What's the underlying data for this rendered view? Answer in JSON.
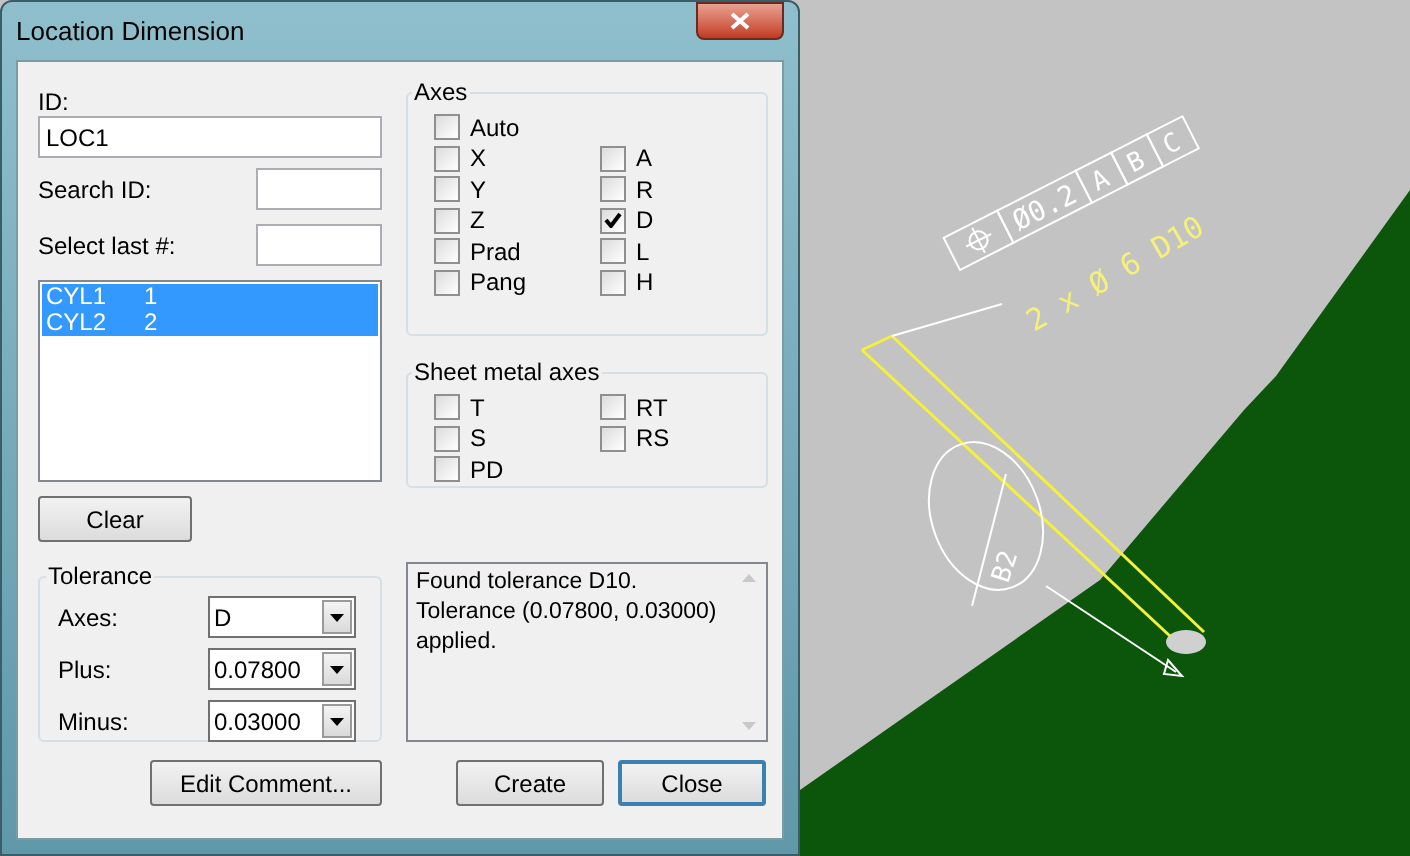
{
  "window": {
    "title": "Location Dimension"
  },
  "id_field": {
    "label": "ID:",
    "value": "LOC1"
  },
  "search_id": {
    "label": "Search ID:"
  },
  "select_last": {
    "label": "Select last #:"
  },
  "feature_list": [
    {
      "name": "CYL1",
      "number": "1",
      "selected": true
    },
    {
      "name": "CYL2",
      "number": "2",
      "selected": true
    }
  ],
  "clear_button": "Clear",
  "axes": {
    "title": "Axes",
    "rows": [
      [
        {
          "label": "Auto",
          "checked": false
        }
      ],
      [
        {
          "label": "X",
          "checked": false
        },
        {
          "label": "A",
          "checked": false
        }
      ],
      [
        {
          "label": "Y",
          "checked": false
        },
        {
          "label": "R",
          "checked": false
        }
      ],
      [
        {
          "label": "Z",
          "checked": false
        },
        {
          "label": "D",
          "checked": true
        }
      ],
      [
        {
          "label": "Prad",
          "checked": false
        },
        {
          "label": "L",
          "checked": false
        }
      ],
      [
        {
          "label": "Pang",
          "checked": false
        },
        {
          "label": "H",
          "checked": false
        }
      ]
    ]
  },
  "sheet_metal_axes": {
    "title": "Sheet metal axes",
    "rows": [
      [
        {
          "label": "T",
          "checked": false
        },
        {
          "label": "RT",
          "checked": false
        }
      ],
      [
        {
          "label": "S",
          "checked": false
        },
        {
          "label": "RS",
          "checked": false
        }
      ],
      [
        {
          "label": "PD",
          "checked": false
        }
      ]
    ]
  },
  "tolerance": {
    "title": "Tolerance",
    "fields": [
      {
        "label": "Axes:",
        "value": "D"
      },
      {
        "label": "Plus:",
        "value": "0.07800"
      },
      {
        "label": "Minus:",
        "value": "0.03000"
      }
    ]
  },
  "message": "Found tolerance D10.\nTolerance (0.07800, 0.03000)\napplied.",
  "buttons": [
    {
      "label": "Edit Comment...",
      "default": false
    },
    {
      "label": "Create",
      "default": false
    },
    {
      "label": "Close",
      "default": true
    }
  ],
  "viewport": {
    "feature_control_frame": {
      "tolerance": "Ø0.2",
      "datums": [
        "A",
        "B",
        "C"
      ]
    },
    "note": "2 x Ø 6 D10",
    "balloon": "B2"
  }
}
